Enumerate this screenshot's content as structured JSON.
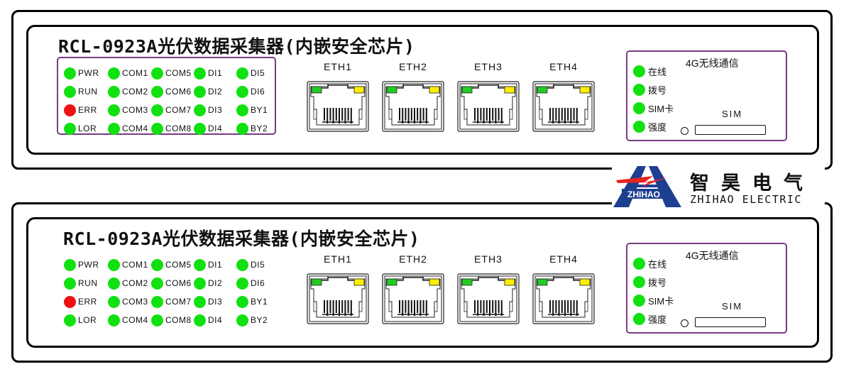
{
  "panels": [
    {
      "title": "RCL-0923A光伏数据采集器(内嵌安全芯片)",
      "led_box_bordered": true,
      "leds": [
        {
          "label": "PWR",
          "color": "green"
        },
        {
          "label": "COM1",
          "color": "green"
        },
        {
          "label": "COM5",
          "color": "green"
        },
        {
          "label": "DI1",
          "color": "green"
        },
        {
          "label": "DI5",
          "color": "green"
        },
        {
          "label": "RUN",
          "color": "green"
        },
        {
          "label": "COM2",
          "color": "green"
        },
        {
          "label": "COM6",
          "color": "green"
        },
        {
          "label": "DI2",
          "color": "green"
        },
        {
          "label": "DI6",
          "color": "green"
        },
        {
          "label": "ERR",
          "color": "red"
        },
        {
          "label": "COM3",
          "color": "green"
        },
        {
          "label": "COM7",
          "color": "green"
        },
        {
          "label": "DI3",
          "color": "green"
        },
        {
          "label": "BY1",
          "color": "green"
        },
        {
          "label": "LOR",
          "color": "green"
        },
        {
          "label": "COM4",
          "color": "green"
        },
        {
          "label": "COM8",
          "color": "green"
        },
        {
          "label": "DI4",
          "color": "green"
        },
        {
          "label": "BY2",
          "color": "green"
        }
      ],
      "eth_ports": [
        "ETH1",
        "ETH2",
        "ETH3",
        "ETH4"
      ],
      "wireless": {
        "title": "4G无线通信",
        "leds": [
          {
            "label": "在线",
            "color": "green"
          },
          {
            "label": "拨号",
            "color": "green"
          },
          {
            "label": "SIM卡",
            "color": "green"
          },
          {
            "label": "强度",
            "color": "green"
          }
        ],
        "sim_label": "SIM"
      }
    },
    {
      "title": "RCL-0923A光伏数据采集器(内嵌安全芯片)",
      "led_box_bordered": false,
      "leds": [
        {
          "label": "PWR",
          "color": "green"
        },
        {
          "label": "COM1",
          "color": "green"
        },
        {
          "label": "COM5",
          "color": "green"
        },
        {
          "label": "DI1",
          "color": "green"
        },
        {
          "label": "DI5",
          "color": "green"
        },
        {
          "label": "RUN",
          "color": "green"
        },
        {
          "label": "COM2",
          "color": "green"
        },
        {
          "label": "COM6",
          "color": "green"
        },
        {
          "label": "DI2",
          "color": "green"
        },
        {
          "label": "DI6",
          "color": "green"
        },
        {
          "label": "ERR",
          "color": "red"
        },
        {
          "label": "COM3",
          "color": "green"
        },
        {
          "label": "COM7",
          "color": "green"
        },
        {
          "label": "DI3",
          "color": "green"
        },
        {
          "label": "BY1",
          "color": "green"
        },
        {
          "label": "LOR",
          "color": "green"
        },
        {
          "label": "COM4",
          "color": "green"
        },
        {
          "label": "COM8",
          "color": "green"
        },
        {
          "label": "DI4",
          "color": "green"
        },
        {
          "label": "BY2",
          "color": "green"
        }
      ],
      "eth_ports": [
        "ETH1",
        "ETH2",
        "ETH3",
        "ETH4"
      ],
      "wireless": {
        "title": "4G无线通信",
        "leds": [
          {
            "label": "在线",
            "color": "green"
          },
          {
            "label": "拨号",
            "color": "green"
          },
          {
            "label": "SIM卡",
            "color": "green"
          },
          {
            "label": "强度",
            "color": "green"
          }
        ],
        "sim_label": "SIM"
      }
    }
  ],
  "logo": {
    "mark_text": "ZHIHAO",
    "name_cn": "智昊电气",
    "name_en": "ZHIHAO ELECTRIC"
  },
  "colors": {
    "led_green": "#11e011",
    "led_red": "#ee1111",
    "eth_led_green": "#22cc22",
    "eth_led_yellow": "#ffee00",
    "box_border": "#7a3a86",
    "logo_blue": "#1d3f8f",
    "logo_red": "#e52421"
  }
}
